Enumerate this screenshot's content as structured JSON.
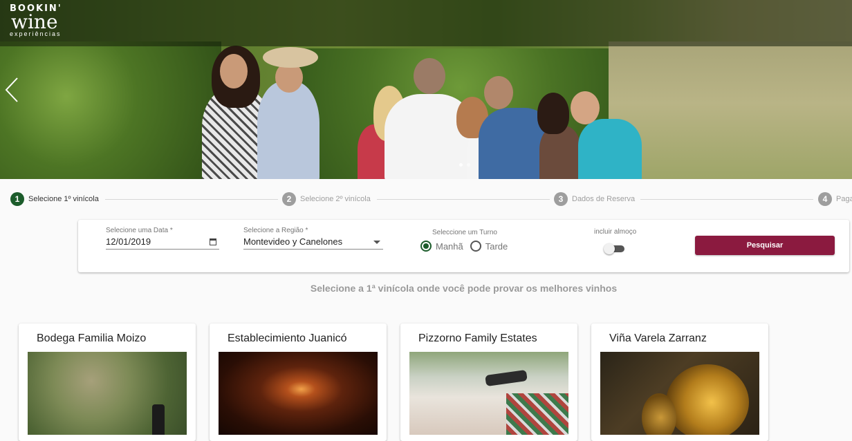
{
  "brand": {
    "line1": "BOOKIN'",
    "line2": "wine",
    "line3": "experiências"
  },
  "stepper": [
    {
      "number": "1",
      "label": "Selecione 1º vinícola",
      "active": true
    },
    {
      "number": "2",
      "label": "Selecione 2º vinícola",
      "active": false
    },
    {
      "number": "3",
      "label": "Dados de Reserva",
      "active": false
    },
    {
      "number": "4",
      "label": "Paga",
      "active": false
    }
  ],
  "search": {
    "date_label": "Selecione uma Data *",
    "date_value": "12/01/2019",
    "region_label": "Selecione a Região *",
    "region_value": "Montevideo y Canelones",
    "turno_label": "Seleccione um Turno",
    "turno_options": [
      "Manhã",
      "Tarde"
    ],
    "turno_selected": "Manhã",
    "lunch_label": "incluir almoço",
    "lunch_enabled": false,
    "button_label": "Pesquisar"
  },
  "headline": "Selecione a 1ª vinícola onde você pode provar os melhores vinhos",
  "wineries": [
    {
      "name": "Bodega Familia Moizo"
    },
    {
      "name": "Establecimiento Juanicó"
    },
    {
      "name": "Pizzorno Family Estates"
    },
    {
      "name": "Viña Varela Zarranz"
    }
  ],
  "colors": {
    "accent_green": "#1c5c2b",
    "button_bordeaux": "#8b1a3f",
    "step_inactive": "#9e9e9e"
  }
}
